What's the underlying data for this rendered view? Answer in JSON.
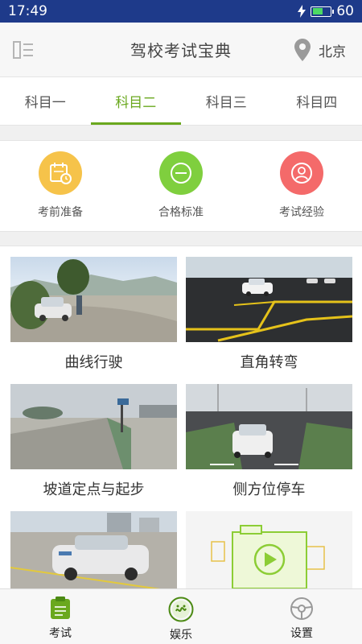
{
  "status": {
    "time": "17:49",
    "battery": "60"
  },
  "header": {
    "title": "驾校考试宝典",
    "location": "北京"
  },
  "tabs": [
    {
      "label": "科目一",
      "active": false
    },
    {
      "label": "科目二",
      "active": true
    },
    {
      "label": "科目三",
      "active": false
    },
    {
      "label": "科目四",
      "active": false
    }
  ],
  "quick": [
    {
      "label": "考前准备",
      "icon": "calendar-clock-icon",
      "color": "#f6c34a"
    },
    {
      "label": "合格标准",
      "icon": "minus-circle-icon",
      "color": "#7fcf3e"
    },
    {
      "label": "考试经验",
      "icon": "person-icon",
      "color": "#f46a6a"
    }
  ],
  "cards": [
    {
      "caption": "曲线行驶",
      "image": "car-on-curve-photo"
    },
    {
      "caption": "直角转弯",
      "image": "car-right-angle-turn-photo"
    },
    {
      "caption": "坡道定点与起步",
      "image": "ramp-photo"
    },
    {
      "caption": "侧方位停车",
      "image": "side-parking-photo"
    },
    {
      "caption": "",
      "image": "car-photo"
    },
    {
      "caption": "",
      "image": "video-camera-illustration"
    }
  ],
  "bottom_nav": [
    {
      "label": "考试",
      "icon": "exam-book-icon",
      "active": true
    },
    {
      "label": "娱乐",
      "icon": "fun-smile-icon",
      "active": false
    },
    {
      "label": "设置",
      "icon": "steering-wheel-icon",
      "active": false
    }
  ],
  "colors": {
    "accent": "#6aa81e",
    "status_bar": "#1e3a8a"
  }
}
